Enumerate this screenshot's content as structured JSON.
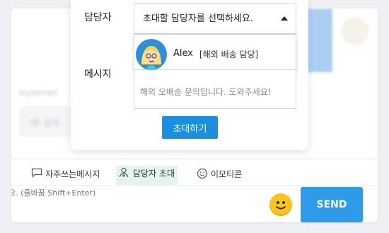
{
  "background": {
    "username": "styleman",
    "bubble_text": "네! 감사"
  },
  "popup": {
    "manager_label": "담당자",
    "manager_select_value": "초대할 담당자를 선택하세요.",
    "dropdown_options": [
      {
        "name": "Alex",
        "role": "[해외 배송 담당]"
      }
    ],
    "message_label": "메시지",
    "message_placeholder": "해외 오배송 문의입니다. 도와주세요!",
    "invite_button": "초대하기"
  },
  "toolbar": {
    "frequent_messages": "자주쓰는메시지",
    "invite_manager": "담당자 초대",
    "emoticon": "이모티콘"
  },
  "input": {
    "hint": "요. (줄바꿈 Shift+Enter)",
    "send_button": "SEND"
  },
  "colors": {
    "accent": "#1a8fe0",
    "send": "#2f9be8",
    "highlight": "#e4f4ee",
    "emoji": "#f7c51c"
  }
}
